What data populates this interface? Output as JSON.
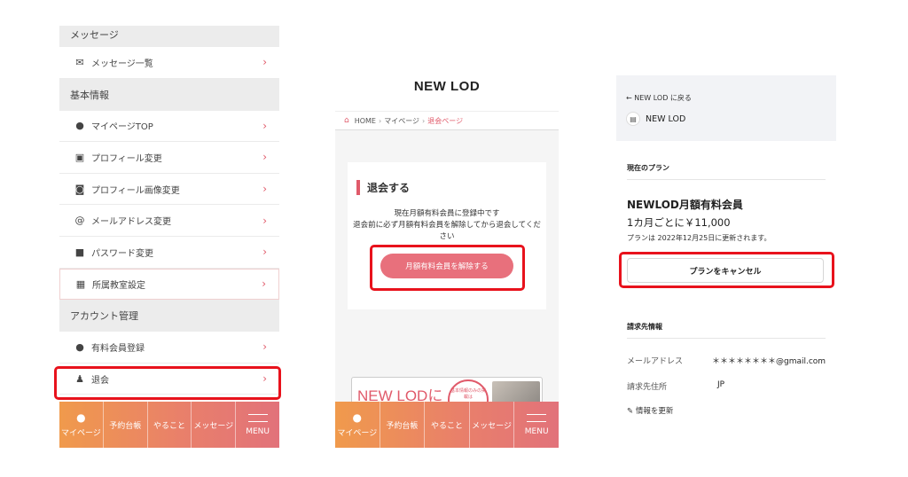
{
  "colors": {
    "accent": "#e05a6a",
    "highlight": "#e8121c",
    "nav_start": "#f09a4c",
    "nav_end": "#e2727a"
  },
  "panel1": {
    "sections": {
      "message": "メッセージ",
      "basic": "基本情報",
      "account": "アカウント管理"
    },
    "items": [
      {
        "label": "メッセージ一覧",
        "icon": "mail-icon"
      },
      {
        "label": "マイページTOP",
        "icon": "user-icon"
      },
      {
        "label": "プロフィール変更",
        "icon": "id-card-icon"
      },
      {
        "label": "プロフィール画像変更",
        "icon": "camera-icon"
      },
      {
        "label": "メールアドレス変更",
        "icon": "at-icon"
      },
      {
        "label": "パスワード変更",
        "icon": "lock-icon"
      },
      {
        "label": "所属教室設定",
        "icon": "building-icon"
      },
      {
        "label": "有料会員登録",
        "icon": "piggy-bank-icon"
      },
      {
        "label": "退会",
        "icon": "user-exit-icon"
      }
    ],
    "chevron": "›"
  },
  "bottom_nav": [
    {
      "label": "マイページ",
      "icon": "user-icon"
    },
    {
      "label": "予約台帳",
      "icon": ""
    },
    {
      "label": "やること",
      "icon": ""
    },
    {
      "label": "メッセージ",
      "icon": ""
    },
    {
      "label": "MENU",
      "icon": "hamburger-icon"
    }
  ],
  "panel2": {
    "header": "NEW LOD",
    "breadcrumb": {
      "home": "HOME",
      "mypage": "マイページ",
      "current": "退会ページ"
    },
    "card_title": "退会する",
    "message_line1": "現在月額有料会員に登録中です",
    "message_line2": "退会前に必ず月額有料会員を解除してから退会してください",
    "cta": "月額有料会員を解除する",
    "banner_text": "NEW LODに",
    "banner_badge": "基本情報のみの掲載は"
  },
  "panel3": {
    "back": "← NEW LOD に戻る",
    "brand": "NEW LOD",
    "current_plan_label": "現在のプラン",
    "plan_name": "NEWLOD月額有料会員",
    "price": "1カ月ごとに￥11,000",
    "renewal": "プランは 2022年12月25日に更新されます。",
    "cancel": "プランをキャンセル",
    "billing_label": "請求先情報",
    "email_label": "メールアドレス",
    "email_value": "＊＊＊＊＊＊＊＊@gmail.com",
    "address_label": "請求先住所",
    "address_value": "JP",
    "update": "情報を更新"
  }
}
